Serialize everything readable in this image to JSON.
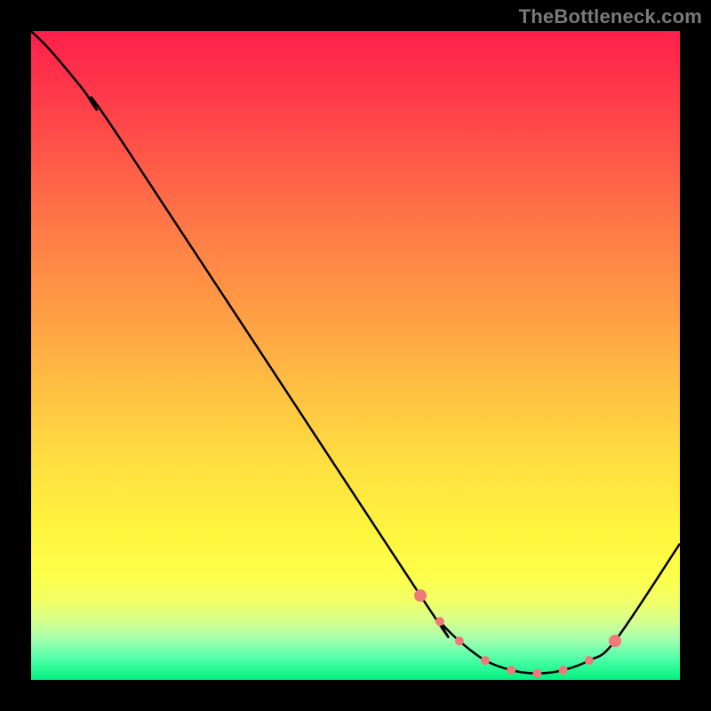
{
  "watermark": "TheBottleneck.com",
  "chart_data": {
    "type": "line",
    "title": "",
    "xlabel": "",
    "ylabel": "",
    "xlim": [
      0,
      100
    ],
    "ylim": [
      0,
      100
    ],
    "series": [
      {
        "name": "curve",
        "x": [
          0,
          3,
          8,
          10,
          14,
          60,
          63,
          66,
          70,
          74,
          78,
          82,
          86,
          90,
          100
        ],
        "y": [
          100,
          97,
          91,
          88,
          83,
          13,
          9,
          6,
          3,
          1.5,
          1,
          1.5,
          3,
          6,
          21
        ]
      }
    ],
    "markers": {
      "name": "highlight-points",
      "color": "#f07878",
      "x": [
        60,
        63,
        66,
        70,
        74,
        78,
        82,
        86,
        90
      ],
      "y": [
        13,
        9,
        6,
        3,
        1.5,
        1,
        1.5,
        3,
        6
      ]
    },
    "gradient_stops": [
      {
        "pos": 0.0,
        "color": "#ff1f4b"
      },
      {
        "pos": 0.5,
        "color": "#ffb043"
      },
      {
        "pos": 0.85,
        "color": "#f8ff55"
      },
      {
        "pos": 1.0,
        "color": "#00f07e"
      }
    ]
  }
}
